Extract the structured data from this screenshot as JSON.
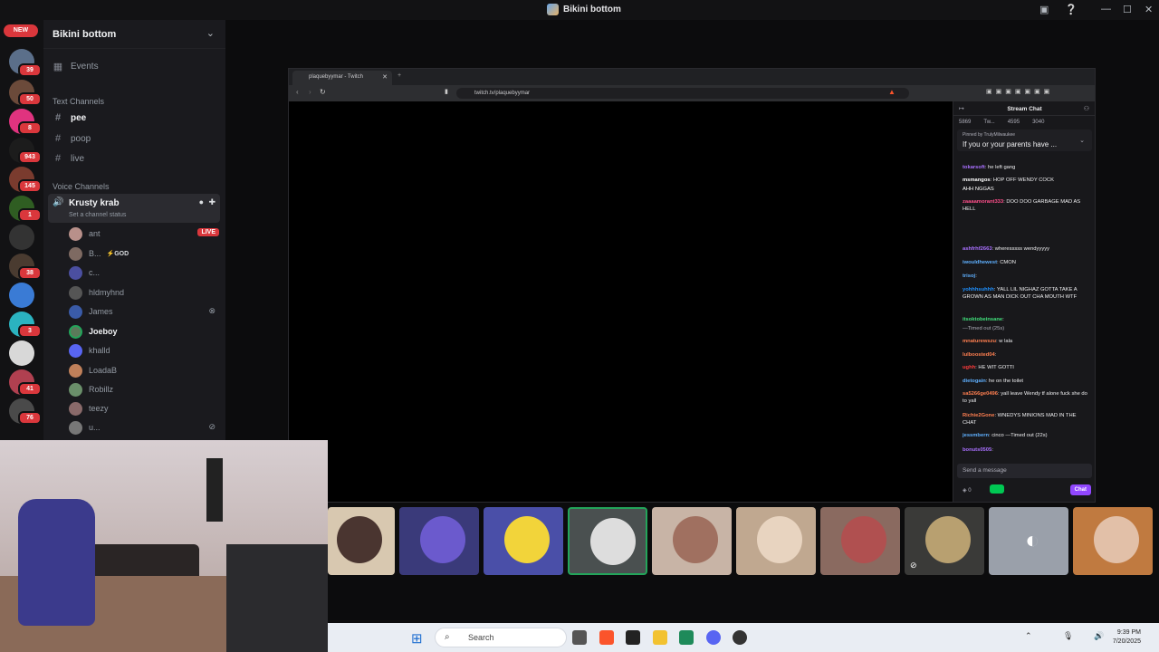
{
  "window": {
    "title": "Bikini bottom"
  },
  "rail": {
    "new_label": "NEW",
    "badges": [
      "39",
      "50",
      "8",
      "943",
      "145",
      "1",
      "38",
      "3",
      "41",
      "76"
    ]
  },
  "sidebar": {
    "server_name": "Bikini bottom",
    "events_label": "Events",
    "text_category": "Text Channels",
    "text_channels": [
      "pee",
      "poop",
      "live"
    ],
    "voice_category": "Voice Channels",
    "voice_channel": {
      "name": "Krusty krab",
      "status": "Set a channel status"
    },
    "voice_users": [
      {
        "name": "ant",
        "live": "LIVE"
      },
      {
        "name": "B...",
        "tag": "⚡GOD"
      },
      {
        "name": "c..."
      },
      {
        "name": "hldmyhnd"
      },
      {
        "name": "James"
      },
      {
        "name": "Joeboy"
      },
      {
        "name": "khalld"
      },
      {
        "name": "LoadaB"
      },
      {
        "name": "Robillz"
      },
      {
        "name": "teezy"
      },
      {
        "name": "u..."
      }
    ]
  },
  "browser": {
    "tab_title": "plaquebyymar - Twitch",
    "url": "twitch.tv/plaquebyymar"
  },
  "chat": {
    "title": "Stream Chat",
    "stats": [
      "5869",
      "Tw...",
      "4595",
      "3040"
    ],
    "pinned_by": "Pinned by TrulyMilwaukee",
    "pinned_text": "If you or your parents have ...",
    "messages": [
      {
        "user": "tokarsoft",
        "text": "he left gang",
        "color": "#a970ff"
      },
      {
        "user": "msmangos",
        "text": "HOP OFF WENDY COCK",
        "color": "#ffffff"
      },
      {
        "user": "",
        "text": "AHH NGGAS",
        "color": "#ffffff"
      },
      {
        "user": "zaaaamorant333",
        "text": "DOO DOO GARBAGE MAD AS HELL",
        "color": "#ff4f8b"
      },
      {
        "user": "ashfrhf2663",
        "text": "wheresssss wendyyyyy",
        "color": "#a970ff"
      },
      {
        "user": "iwouldhewest",
        "text": "CMON",
        "color": "#5fb0ff"
      },
      {
        "user": "trisoj",
        "text": "",
        "color": "#5fb0ff"
      },
      {
        "user": "yohhhsuhhh",
        "text": "YALL LIL NIGHAZ GOTTA TAKE A GROWN AS MAN DICK OUT CHA MOUTH WTF",
        "color": "#1e90ff"
      },
      {
        "user": "itsoktobeinsane",
        "text": "",
        "color": "#40e07b"
      },
      {
        "user": "",
        "text": "—Timed out (25s)",
        "color": "#adadb8"
      },
      {
        "user": "mnaturewszu",
        "text": "w lala",
        "color": "#ff7f50"
      },
      {
        "user": "lulboosted04",
        "text": "",
        "color": "#ff7f50"
      },
      {
        "user": "ughh",
        "text": "HE WIT GOTTI",
        "color": "#ff3b3b"
      },
      {
        "user": "dietogain",
        "text": "he on the toilet",
        "color": "#5fb0ff"
      },
      {
        "user": "sa5266ge0496",
        "text": "yall leave Wendy tf alone fuck she do to yall",
        "color": "#ff7f50"
      },
      {
        "user": "Richie2Gone",
        "text": "WNEDYS MINIONS MAD IN THE CHAT",
        "color": "#ff7f50"
      },
      {
        "user": "jessmbern",
        "text": "cinco —Timed out (22s)",
        "color": "#5fb0ff"
      },
      {
        "user": "bonuts0505",
        "text": "",
        "color": "#a970ff"
      }
    ],
    "input_placeholder": "Send a message",
    "points": "0",
    "chat_button": "Chat"
  },
  "taskbar": {
    "search_label": "Search",
    "time": "9:39 PM",
    "date": "7/20/2025"
  }
}
